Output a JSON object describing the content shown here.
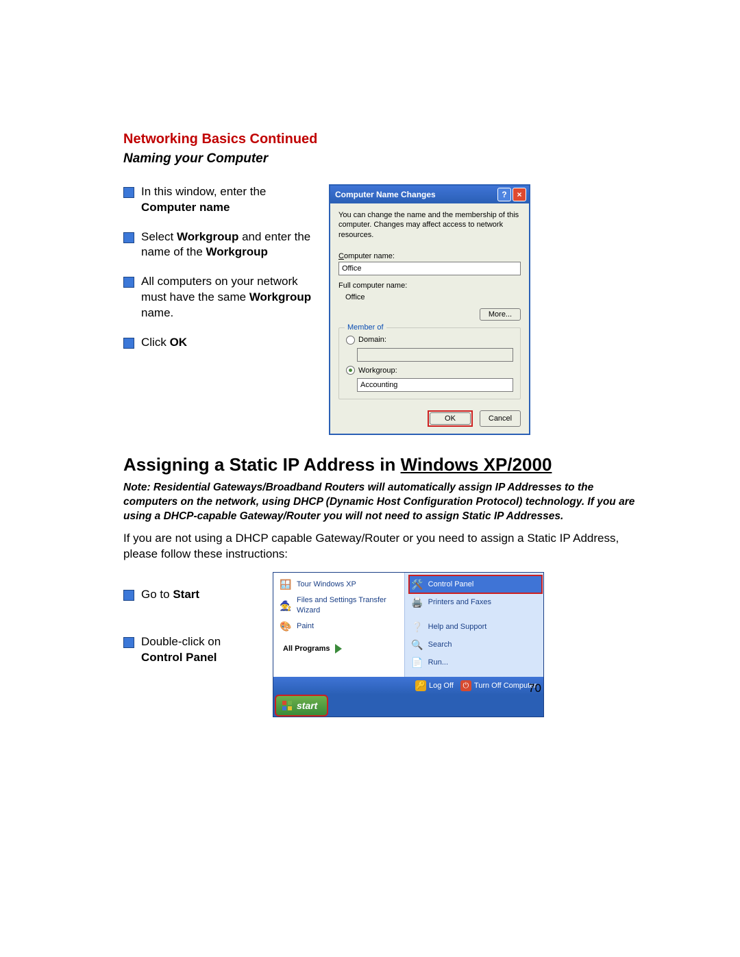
{
  "heading": "Networking Basics Continued",
  "subheading": "Naming your Computer",
  "bullets1": [
    {
      "pre": "In this window, enter the ",
      "bold": "Computer name",
      "post": ""
    },
    {
      "pre": "Select ",
      "bold": "Workgroup",
      "mid": " and enter the name of the ",
      "bold2": "Workgroup",
      "post": ""
    },
    {
      "pre": "All computers on your network must have the same ",
      "bold": "Workgroup",
      "post": " name."
    },
    {
      "pre": "Click ",
      "bold": "OK",
      "post": ""
    }
  ],
  "dialog": {
    "title": "Computer Name Changes",
    "desc": "You can change the name and the membership of this computer. Changes may affect access to network resources.",
    "computer_name_label_pre": "C",
    "computer_name_label_post": "omputer name:",
    "computer_name_value": "Office",
    "full_name_label": "Full computer name:",
    "full_name_value": "Office",
    "more_btn": "More...",
    "member_legend": "Member of",
    "domain_label_pre": "D",
    "domain_label_post": "omain:",
    "domain_value": "",
    "workgroup_label_pre": "W",
    "workgroup_label_post": "orkgroup:",
    "workgroup_value": "Accounting",
    "ok_btn": "OK",
    "cancel_btn": "Cancel"
  },
  "h2_pre": "Assigning a Static IP Address in ",
  "h2_ul": "Windows XP/2000",
  "note": "Note:  Residential Gateways/Broadband Routers will automatically assign IP Addresses to the computers on the network, using DHCP (Dynamic Host Configuration Protocol) technology.  If you are using a DHCP-capable Gateway/Router you will not need to assign Static IP Addresses.",
  "para": "If you are not using a DHCP capable Gateway/Router or you need to assign a Static IP Address, please follow these instructions:",
  "bullets2": [
    {
      "pre": "Go to ",
      "bold": "Start",
      "post": ""
    },
    {
      "pre": "Double-click on ",
      "bold": "Control Panel",
      "post": ""
    }
  ],
  "startmenu": {
    "left": [
      "Tour Windows XP",
      "Files and Settings Transfer Wizard",
      "Paint"
    ],
    "all_programs": "All Programs",
    "right": [
      "Control Panel",
      "Printers and Faxes",
      "Help and Support",
      "Search",
      "Run..."
    ],
    "logoff": "Log Off",
    "turnoff": "Turn Off Computer",
    "start": "start"
  },
  "page_no": "70"
}
